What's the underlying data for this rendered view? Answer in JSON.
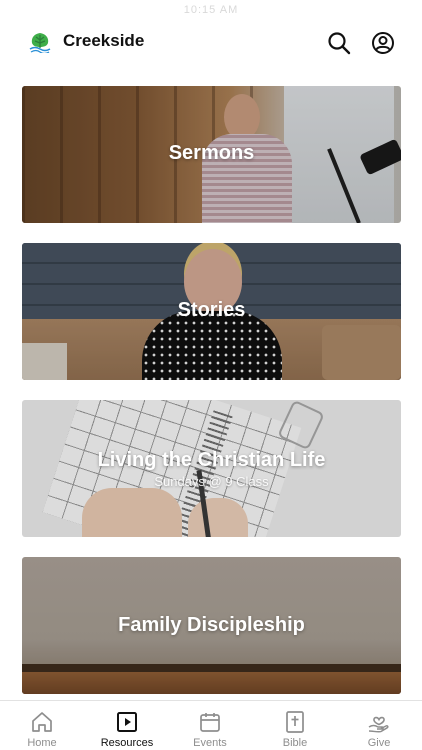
{
  "status": {
    "time": "10:15 AM"
  },
  "header": {
    "title": "Creekside",
    "logo_icon": "tree-logo-icon",
    "search_icon": "search-icon",
    "profile_icon": "profile-icon"
  },
  "cards": [
    {
      "title": "Sermons",
      "subtitle": ""
    },
    {
      "title": "Stories",
      "subtitle": ""
    },
    {
      "title": "Living the Christian Life",
      "subtitle": "Sundays @ 9 Class"
    },
    {
      "title": "Family Discipleship",
      "subtitle": ""
    }
  ],
  "tabbar": {
    "active": "Resources",
    "colors": {
      "active": "#111111",
      "inactive": "#8e8e8e"
    },
    "tabs": [
      {
        "label": "Home",
        "icon": "home-icon"
      },
      {
        "label": "Resources",
        "icon": "play-square-icon"
      },
      {
        "label": "Events",
        "icon": "calendar-icon"
      },
      {
        "label": "Bible",
        "icon": "bible-cross-icon"
      },
      {
        "label": "Give",
        "icon": "heart-hand-icon"
      }
    ]
  }
}
